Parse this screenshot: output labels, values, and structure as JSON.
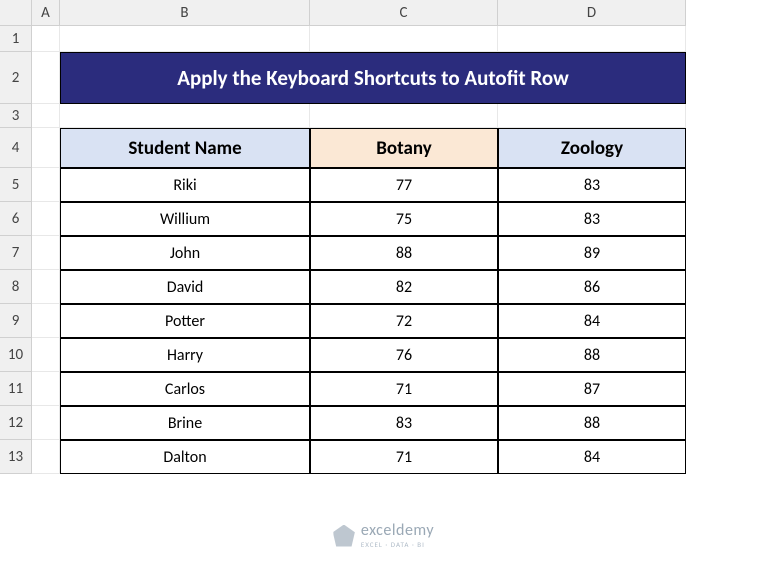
{
  "columns": [
    "A",
    "B",
    "C",
    "D"
  ],
  "rows": [
    "1",
    "2",
    "3",
    "4",
    "5",
    "6",
    "7",
    "8",
    "9",
    "10",
    "11",
    "12",
    "13"
  ],
  "title": "Apply the Keyboard Shortcuts to Autofit Row",
  "headers": {
    "name": "Student Name",
    "botany": "Botany",
    "zoology": "Zoology"
  },
  "data": [
    {
      "name": "Riki",
      "botany": "77",
      "zoology": "83"
    },
    {
      "name": "Willium",
      "botany": "75",
      "zoology": "83"
    },
    {
      "name": "John",
      "botany": "88",
      "zoology": "89"
    },
    {
      "name": "David",
      "botany": "82",
      "zoology": "86"
    },
    {
      "name": "Potter",
      "botany": "72",
      "zoology": "84"
    },
    {
      "name": "Harry",
      "botany": "76",
      "zoology": "88"
    },
    {
      "name": "Carlos",
      "botany": "71",
      "zoology": "87"
    },
    {
      "name": "Brine",
      "botany": "83",
      "zoology": "88"
    },
    {
      "name": "Dalton",
      "botany": "71",
      "zoology": "84"
    }
  ],
  "watermark": {
    "main": "exceldemy",
    "sub": "EXCEL · DATA · BI"
  },
  "chart_data": {
    "type": "table",
    "title": "Apply the Keyboard Shortcuts to Autofit Row",
    "columns": [
      "Student Name",
      "Botany",
      "Zoology"
    ],
    "rows": [
      [
        "Riki",
        77,
        83
      ],
      [
        "Willium",
        75,
        83
      ],
      [
        "John",
        88,
        89
      ],
      [
        "David",
        82,
        86
      ],
      [
        "Potter",
        72,
        84
      ],
      [
        "Harry",
        76,
        88
      ],
      [
        "Carlos",
        71,
        87
      ],
      [
        "Brine",
        83,
        88
      ],
      [
        "Dalton",
        71,
        84
      ]
    ]
  }
}
